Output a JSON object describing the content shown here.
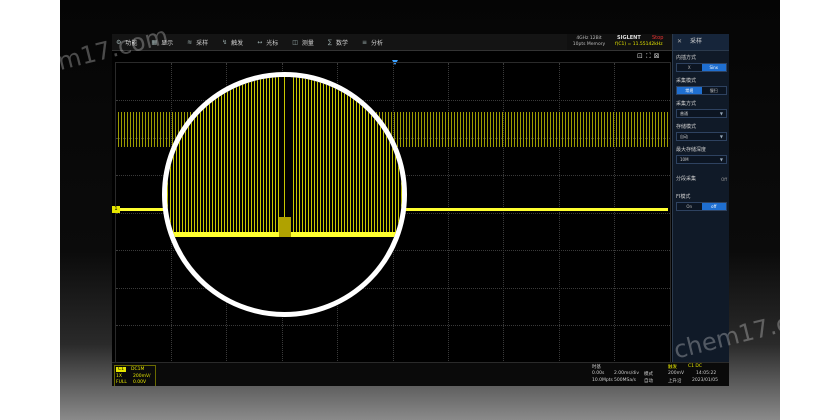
{
  "menu": {
    "items": [
      {
        "icon": "⚙",
        "label": "功能"
      },
      {
        "icon": "▦",
        "label": "显示"
      },
      {
        "icon": "≋",
        "label": "采样"
      },
      {
        "icon": "↯",
        "label": "触发"
      },
      {
        "icon": "↔",
        "label": "光标"
      },
      {
        "icon": "◫",
        "label": "测量"
      },
      {
        "icon": "∑",
        "label": "数学"
      },
      {
        "icon": "≡",
        "label": "分析"
      }
    ]
  },
  "brand": {
    "bandwidth": "4GHz 12Bit",
    "memory": "10pts Memory",
    "name": "SIGLENT",
    "state": "Stop",
    "freq": "f(C1) = 11.55142kHz"
  },
  "toolbar_icons": [
    "⊡",
    "⛶",
    "⊠"
  ],
  "channel_marker": "1",
  "panel": {
    "title": "采样",
    "close_icon": "✕",
    "sections": [
      {
        "type": "seg",
        "label": "内插方式",
        "options": [
          "X",
          "Sinx"
        ],
        "active": 1
      },
      {
        "type": "seg",
        "label": "采集模式",
        "options": [
          "常规",
          "慢扫"
        ],
        "active": 0
      },
      {
        "type": "select",
        "label": "采集方式",
        "value": "普通"
      },
      {
        "type": "select",
        "label": "存储模式",
        "value": "自动"
      },
      {
        "type": "select",
        "label": "最大存储深度",
        "value": "10M"
      },
      {
        "type": "toggle",
        "label": "分段采集",
        "value": "Off"
      },
      {
        "type": "seg",
        "label": "FI模式",
        "options": [
          "On",
          "off"
        ],
        "active": 1
      }
    ]
  },
  "bottom": {
    "ch1": {
      "tag": "C1",
      "coupling": "DC1M",
      "row2_label": "1X",
      "row2_value": "200mV/",
      "row3_label": "FULL",
      "row3_value": "0.00V"
    },
    "timebase": {
      "label": "时基",
      "delay": "0.00s",
      "scale": "2.00ms/div",
      "pts": "10.0Mpts",
      "rate": "500MSa/s",
      "mode_label": "模式",
      "mode_value": "自动"
    },
    "trigger": {
      "label": "触发",
      "edge": "C1 DC",
      "level": "200mV",
      "slope": "上升沿",
      "time": "14:05:22",
      "date": "2023/01/05"
    }
  },
  "watermark": "chem17.com"
}
